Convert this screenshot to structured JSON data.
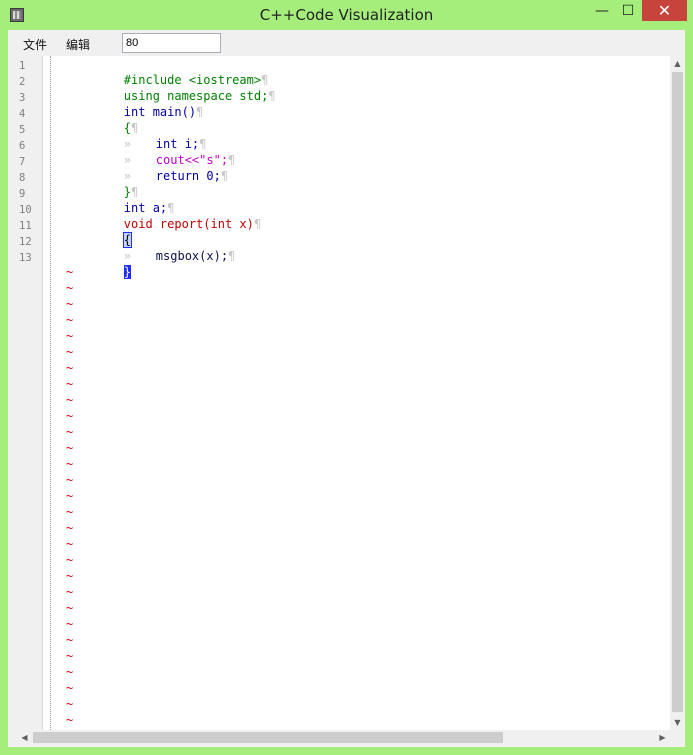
{
  "window": {
    "title": "C++Code Visualization",
    "minimize_glyph": "—",
    "maximize_glyph": "☐",
    "close_glyph": "✕",
    "accent_color": "#a6ee7c",
    "close_color": "#c7443d"
  },
  "menu": {
    "file_label": "文件",
    "edit_label": "编辑",
    "zoom_value": "80"
  },
  "editor": {
    "line_numbers": [
      "1",
      "2",
      "3",
      "4",
      "5",
      "6",
      "7",
      "8",
      "9",
      "10",
      "11",
      "12",
      "13"
    ],
    "pilcrow": "¶",
    "tab_glyph": "»",
    "tilde": "~",
    "tilde_count": 29,
    "lines": [
      "#include <iostream>",
      "using namespace std;",
      "int main()",
      "{",
      "int i;",
      "cout<<\"s\";",
      "return 0;",
      "}",
      "int a;",
      "void report(int x)",
      "{",
      "msgbox(x);",
      "}"
    ]
  },
  "scrollbars": {
    "up_arrow": "▲",
    "down_arrow": "▼",
    "left_arrow": "◀",
    "right_arrow": "▶"
  }
}
